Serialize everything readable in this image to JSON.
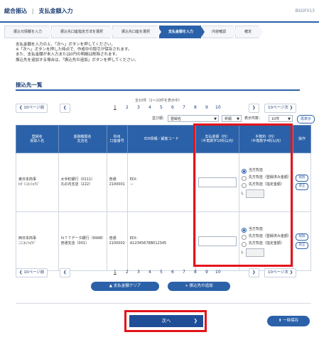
{
  "header": {
    "breadcrumb_root": "総合振込",
    "title": "支払金額入力",
    "screen_id": "BSGF013"
  },
  "steps": [
    "振込元情報を入力",
    "振込先口座指定方法を選択",
    "振込先口座を選択",
    "支払金額を入力",
    "内容確認",
    "確定"
  ],
  "instructions": [
    "支払金額を入力の上、「次へ」ボタンを押してください。",
    "※「次へ」ボタンを押した時点で、作成中の取引が保存されます。",
    "また、支払金額が未入力または0円の明細は削除されます。",
    "振込先を追加する場合は、「振込先の追加」ボタンを押してください。"
  ],
  "section": {
    "title": "振込先一覧",
    "count_text": "全10件（1〜10件を表示中）"
  },
  "pagination": {
    "prev10": "10ページ前",
    "next10": "10ページ次",
    "pages": [
      "1",
      "2",
      "3",
      "4",
      "5",
      "6",
      "7",
      "8",
      "9",
      "10"
    ],
    "current": "1"
  },
  "sort": {
    "label": "並び順：",
    "field": "登録名",
    "order": "昇順",
    "per_page_label": "表示件数：",
    "per_page": "10件",
    "rearrange": "再表示"
  },
  "table": {
    "headers": [
      "登録名\n受取人名",
      "金融機関名\n支店名",
      "科目\n口座番号",
      "EDI情報／顧客コード",
      "支払金額（円）\n（半角数字10桁以内）",
      "手数料（円）\n（半角数字4桁以内）",
      "操作"
    ],
    "rows": [
      {
        "name": "東日本商事",
        "kana": "ﾋｶﾞｼﾆﾎﾝｼｮｳｼﾞ",
        "bank": "大手町銀行（0111）",
        "branch": "丸の内支店（222）",
        "type": "普通",
        "account": "2100001",
        "edi": "EDI：",
        "code": "－",
        "fee_options": [
          "当方負担",
          "先方負担（登録済み金額）",
          "先方負担（指定金額）"
        ],
        "fee_prefix": "L",
        "ops": [
          "削除",
          "修正"
        ]
      },
      {
        "name": "西日本商事",
        "kana": "ﾆｼﾆﾎﾝｼｮｳｼﾞ",
        "bank": "ＮＴＴデータ銀行（9998）",
        "branch": "普通支店（001）",
        "type": "普通",
        "account": "2100002",
        "edi": "EDI：",
        "code": "A12345678B012345",
        "fee_options": [
          "当方負担",
          "先方負担（登録済み金額）",
          "先方負担（指定金額）"
        ],
        "fee_prefix": "L",
        "ops": [
          "削除",
          "修正"
        ]
      }
    ]
  },
  "buttons": {
    "clear_amounts": "支払金額クリア",
    "add_payee": "振込先の追加",
    "next": "次へ",
    "temp_save": "一時保存"
  },
  "colors": {
    "brand": "#2b61a8",
    "highlight": "#e4141b"
  }
}
